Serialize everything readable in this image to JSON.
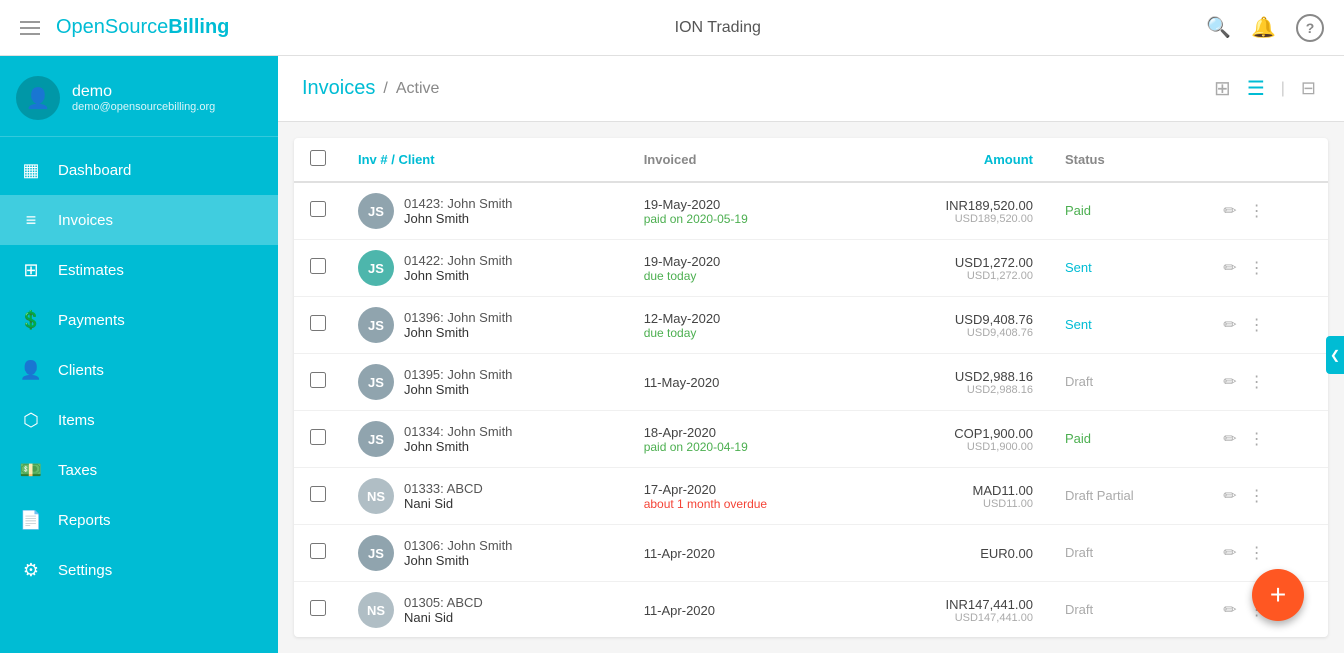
{
  "header": {
    "menu_icon": "☰",
    "brand_text": "OpenSource",
    "brand_bold": "Billing",
    "center_title": "ION Trading",
    "search_icon": "🔍",
    "bell_icon": "🔔",
    "help_icon": "?"
  },
  "sidebar": {
    "user": {
      "name": "demo",
      "email": "demo@opensourcebilling.org",
      "avatar_initials": "👤"
    },
    "nav_items": [
      {
        "id": "dashboard",
        "label": "Dashboard",
        "icon": "▦"
      },
      {
        "id": "invoices",
        "label": "Invoices",
        "icon": "≡",
        "active": true
      },
      {
        "id": "estimates",
        "label": "Estimates",
        "icon": "⊞"
      },
      {
        "id": "payments",
        "label": "Payments",
        "icon": "💲"
      },
      {
        "id": "clients",
        "label": "Clients",
        "icon": "👤"
      },
      {
        "id": "items",
        "label": "Items",
        "icon": "⬡"
      },
      {
        "id": "taxes",
        "label": "Taxes",
        "icon": "💵"
      },
      {
        "id": "reports",
        "label": "Reports",
        "icon": "📄"
      },
      {
        "id": "settings",
        "label": "Settings",
        "icon": "⚙"
      }
    ]
  },
  "page": {
    "title": "Invoices",
    "breadcrumb_separator": "/",
    "subtitle": "Active"
  },
  "table": {
    "columns": [
      {
        "id": "inv_client",
        "label": "Inv # / Client"
      },
      {
        "id": "invoiced",
        "label": "Invoiced"
      },
      {
        "id": "amount",
        "label": "Amount"
      },
      {
        "id": "status",
        "label": "Status"
      }
    ],
    "rows": [
      {
        "avatar_initials": "JS",
        "avatar_color": "#90a4ae",
        "invoice_num": "01423: John Smith",
        "client_name": "John Smith",
        "date": "19-May-2020",
        "date_sub": "paid on 2020-05-19",
        "date_sub_type": "paid",
        "amount_main": "INR189,520.00",
        "amount_usd": "USD189,520.00",
        "status": "Paid",
        "status_type": "paid"
      },
      {
        "avatar_initials": "JS",
        "avatar_color": "#4db6ac",
        "invoice_num": "01422: John Smith",
        "client_name": "John Smith",
        "date": "19-May-2020",
        "date_sub": "due today",
        "date_sub_type": "due",
        "amount_main": "USD1,272.00",
        "amount_usd": "USD1,272.00",
        "status": "Sent",
        "status_type": "sent"
      },
      {
        "avatar_initials": "JS",
        "avatar_color": "#90a4ae",
        "invoice_num": "01396: John Smith",
        "client_name": "John Smith",
        "date": "12-May-2020",
        "date_sub": "due today",
        "date_sub_type": "due",
        "amount_main": "USD9,408.76",
        "amount_usd": "USD9,408.76",
        "status": "Sent",
        "status_type": "sent"
      },
      {
        "avatar_initials": "JS",
        "avatar_color": "#90a4ae",
        "invoice_num": "01395: John Smith",
        "client_name": "John Smith",
        "date": "11-May-2020",
        "date_sub": "",
        "date_sub_type": "",
        "amount_main": "USD2,988.16",
        "amount_usd": "USD2,988.16",
        "status": "Draft",
        "status_type": "draft"
      },
      {
        "avatar_initials": "JS",
        "avatar_color": "#90a4ae",
        "invoice_num": "01334: John Smith",
        "client_name": "John Smith",
        "date": "18-Apr-2020",
        "date_sub": "paid on 2020-04-19",
        "date_sub_type": "paid",
        "amount_main": "COP1,900.00",
        "amount_usd": "USD1,900.00",
        "status": "Paid",
        "status_type": "paid"
      },
      {
        "avatar_initials": "NS",
        "avatar_color": "#b0bec5",
        "invoice_num": "01333: ABCD",
        "client_name": "Nani Sid",
        "date": "17-Apr-2020",
        "date_sub": "about 1 month overdue",
        "date_sub_type": "overdue",
        "amount_main": "MAD11.00",
        "amount_usd": "USD11.00",
        "status": "Draft Partial",
        "status_type": "draft-partial"
      },
      {
        "avatar_initials": "JS",
        "avatar_color": "#90a4ae",
        "invoice_num": "01306: John Smith",
        "client_name": "John Smith",
        "date": "11-Apr-2020",
        "date_sub": "",
        "date_sub_type": "",
        "amount_main": "EUR0.00",
        "amount_usd": "",
        "status": "Draft",
        "status_type": "draft"
      },
      {
        "avatar_initials": "NS",
        "avatar_color": "#b0bec5",
        "invoice_num": "01305: ABCD",
        "client_name": "Nani Sid",
        "date": "11-Apr-2020",
        "date_sub": "",
        "date_sub_type": "",
        "amount_main": "INR147,441.00",
        "amount_usd": "USD147,441.00",
        "status": "Draft",
        "status_type": "draft"
      }
    ]
  },
  "fab": {
    "icon": "+",
    "label": "Add Invoice"
  }
}
